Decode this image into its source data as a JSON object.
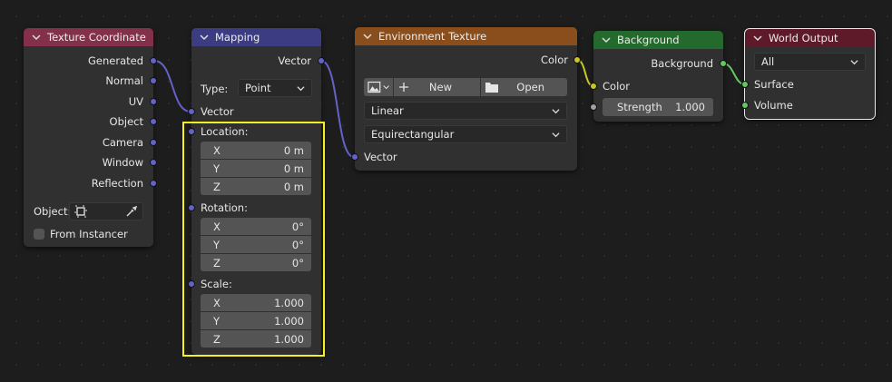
{
  "colors": {
    "texture_header": "#83314a",
    "mapping_header": "#3c3c83",
    "env_header": "#8a4e1c",
    "background_header": "#246a2d",
    "output_header": "#5f1a2a",
    "vector_socket": "#6363c7",
    "color_socket": "#c7c729",
    "shader_socket": "#63c763",
    "highlight": "#f5f020"
  },
  "texcoord": {
    "title": "Texture Coordinate",
    "outputs": [
      "Generated",
      "Normal",
      "UV",
      "Object",
      "Camera",
      "Window",
      "Reflection"
    ],
    "object_label": "Object:",
    "object_icon": "object-icon",
    "picker_icon": "eyedropper-icon",
    "from_instancer": "From Instancer"
  },
  "mapping": {
    "title": "Mapping",
    "output": "Vector",
    "type_label": "Type:",
    "type_value": "Point",
    "vector_input": "Vector",
    "location_label": "Location:",
    "location": [
      {
        "axis": "X",
        "value": "0 m"
      },
      {
        "axis": "Y",
        "value": "0 m"
      },
      {
        "axis": "Z",
        "value": "0 m"
      }
    ],
    "rotation_label": "Rotation:",
    "rotation": [
      {
        "axis": "X",
        "value": "0°"
      },
      {
        "axis": "Y",
        "value": "0°"
      },
      {
        "axis": "Z",
        "value": "0°"
      }
    ],
    "scale_label": "Scale:",
    "scale": [
      {
        "axis": "X",
        "value": "1.000"
      },
      {
        "axis": "Y",
        "value": "1.000"
      },
      {
        "axis": "Z",
        "value": "1.000"
      }
    ]
  },
  "env": {
    "title": "Environment Texture",
    "output": "Color",
    "new_label": "New",
    "open_label": "Open",
    "interpolation": "Linear",
    "projection": "Equirectangular",
    "vector_input": "Vector"
  },
  "background": {
    "title": "Background",
    "output": "Background",
    "color_label": "Color",
    "strength_label": "Strength",
    "strength_value": "1.000"
  },
  "output": {
    "title": "World Output",
    "target": "All",
    "surface": "Surface",
    "volume": "Volume"
  }
}
